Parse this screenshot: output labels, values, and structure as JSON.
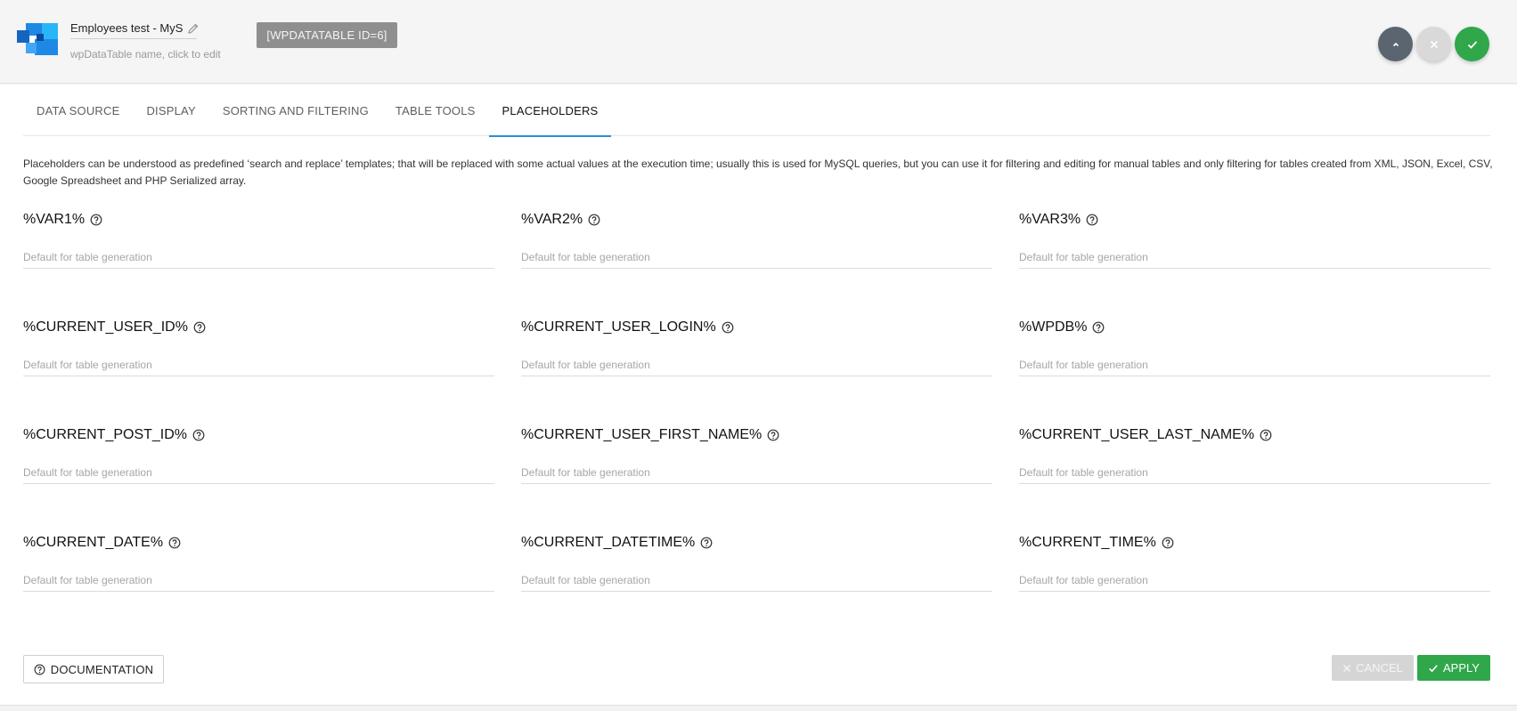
{
  "header": {
    "table_name": "Employees test - MySQL",
    "subtitle": "wpDataTable name, click to edit",
    "shortcode": "[WPDATATABLE ID=6]"
  },
  "tabs": [
    {
      "label": "DATA SOURCE",
      "active": false
    },
    {
      "label": "DISPLAY",
      "active": false
    },
    {
      "label": "SORTING AND FILTERING",
      "active": false
    },
    {
      "label": "TABLE TOOLS",
      "active": false
    },
    {
      "label": "PLACEHOLDERS",
      "active": true
    }
  ],
  "intro": "Placeholders can be understood as predefined ‘search and replace’ templates; that will be replaced with some actual values at the execution time; usually this is used for MySQL queries, but you can use it for filtering and editing for manual tables and only filtering for tables created from XML, JSON, Excel, CSV, Google Spreadsheet and PHP Serialized array.",
  "placeholder_text": "Default for table generation",
  "fields": [
    {
      "label": "%VAR1%",
      "value": ""
    },
    {
      "label": "%VAR2%",
      "value": ""
    },
    {
      "label": "%VAR3%",
      "value": ""
    },
    {
      "label": "%CURRENT_USER_ID%",
      "value": ""
    },
    {
      "label": "%CURRENT_USER_LOGIN%",
      "value": ""
    },
    {
      "label": "%WPDB%",
      "value": ""
    },
    {
      "label": "%CURRENT_POST_ID%",
      "value": ""
    },
    {
      "label": "%CURRENT_USER_FIRST_NAME%",
      "value": ""
    },
    {
      "label": "%CURRENT_USER_LAST_NAME%",
      "value": ""
    },
    {
      "label": "%CURRENT_DATE%",
      "value": ""
    },
    {
      "label": "%CURRENT_DATETIME%",
      "value": ""
    },
    {
      "label": "%CURRENT_TIME%",
      "value": ""
    }
  ],
  "footer": {
    "documentation_label": "DOCUMENTATION",
    "cancel_label": "CANCEL",
    "apply_label": "APPLY"
  },
  "colors": {
    "accent": "#2a8fd8",
    "apply": "#2fa74a",
    "up_button": "#5a6570",
    "shortcode_bg": "#8f8f8f"
  },
  "icons": {
    "logo": "wpdatatables-logo",
    "edit": "pencil-icon",
    "collapse": "chevron-up-icon",
    "close": "close-icon",
    "save": "check-icon",
    "help": "question-circle-icon"
  }
}
